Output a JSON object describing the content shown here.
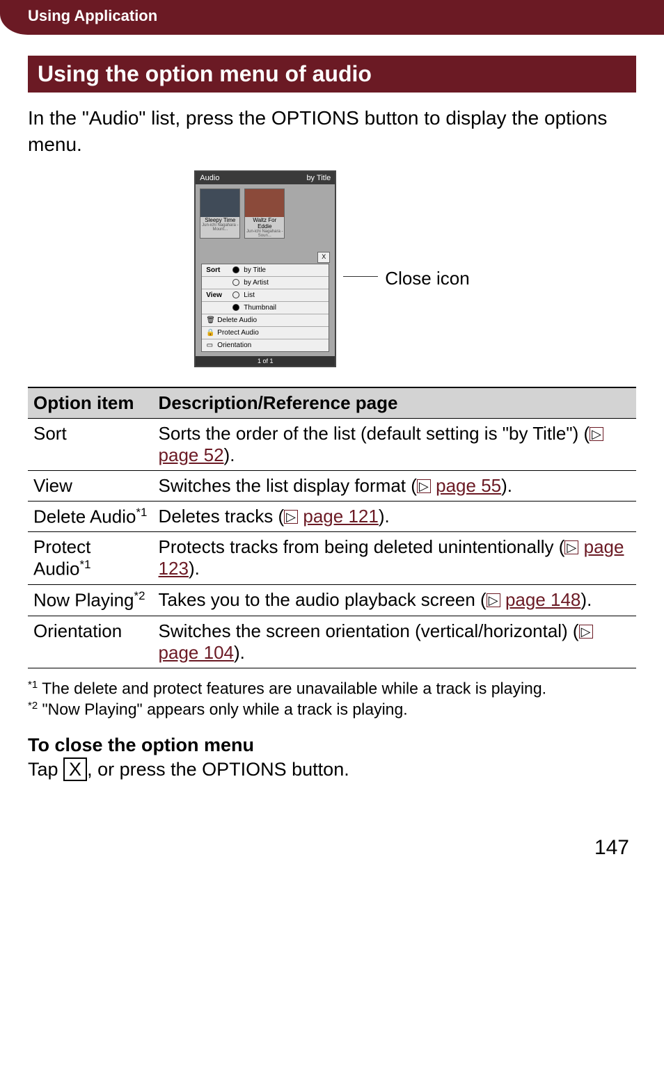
{
  "header": {
    "chapter": "Using Application"
  },
  "section": {
    "title": "Using the option menu of audio"
  },
  "intro": "In the \"Audio\" list, press the OPTIONS button to display the options menu.",
  "screenshot": {
    "title": "Audio",
    "sort_label": "by Title",
    "thumbs": [
      {
        "title": "Sleepy Time",
        "artist": "Jun-ichi Nagahara - Mount..."
      },
      {
        "title": "Waltz For Eddie",
        "artist": "Jun-ichi Nagahara - Soun..."
      }
    ],
    "menu": {
      "sort_label": "Sort",
      "sort_opts": [
        "by Title",
        "by Artist"
      ],
      "view_label": "View",
      "view_opts": [
        "List",
        "Thumbnail"
      ],
      "delete": "Delete Audio",
      "protect": "Protect Audio",
      "orientation": "Orientation"
    },
    "footer": "1 of 1",
    "callout": "Close icon"
  },
  "table": {
    "h1": "Option item",
    "h2": "Description/Reference page",
    "rows": [
      {
        "item": "Sort",
        "sup": "",
        "desc_before": "Sorts the order of the list (default setting is \"by Title\") (",
        "link": "page 52",
        "desc_after": ")."
      },
      {
        "item": "View",
        "sup": "",
        "desc_before": "Switches the list display format (",
        "link": "page 55",
        "desc_after": ")."
      },
      {
        "item": "Delete Audio",
        "sup": "*1",
        "desc_before": "Deletes tracks (",
        "link": "page 121",
        "desc_after": ")."
      },
      {
        "item": "Protect Audio",
        "sup": "*1",
        "desc_before": "Protects tracks from being deleted unintentionally (",
        "link": "page 123",
        "desc_after": ")."
      },
      {
        "item": "Now Playing",
        "sup": "*2",
        "desc_before": "Takes you to the audio playback screen (",
        "link": "page 148",
        "desc_after": ")."
      },
      {
        "item": "Orientation",
        "sup": "",
        "desc_before": "Switches the screen orientation (vertical/horizontal) (",
        "link": "page 104",
        "desc_after": ")."
      }
    ]
  },
  "footnotes": {
    "f1_sup": "*1",
    "f1": " The delete and protect features are unavailable while a track is playing.",
    "f2_sup": "*2",
    "f2": " \"Now Playing\" appears only while a track is playing."
  },
  "close_section": {
    "heading": "To close the option menu",
    "pre": "Tap ",
    "icon": "X",
    "post": ", or press the OPTIONS button."
  },
  "page_number": "147"
}
